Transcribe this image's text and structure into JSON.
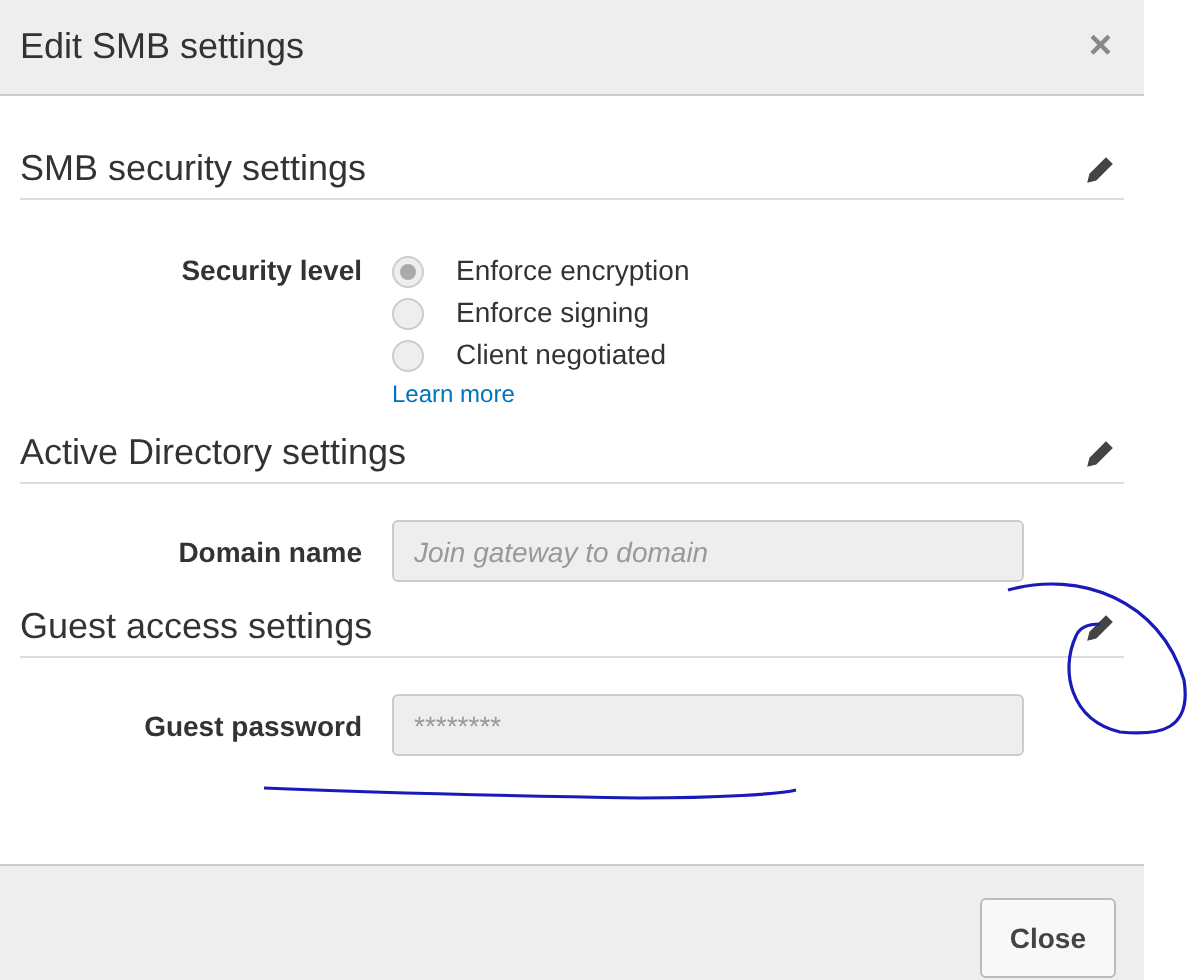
{
  "dialog": {
    "title": "Edit SMB settings",
    "close_icon": "×"
  },
  "sections": [
    {
      "title": "SMB security settings",
      "kind": "radios",
      "label": "Security level",
      "options": [
        {
          "label": "Enforce encryption",
          "selected": true,
          "disabled": true
        },
        {
          "label": "Enforce signing",
          "selected": false,
          "disabled": true
        },
        {
          "label": "Client negotiated",
          "selected": false,
          "disabled": true
        }
      ],
      "link": "Learn more"
    },
    {
      "title": "Active Directory settings",
      "kind": "field",
      "label": "Domain name",
      "placeholder": "Join gateway to domain",
      "disabled": true
    },
    {
      "title": "Guest access settings",
      "kind": "field",
      "label": "Guest password",
      "value": "********",
      "disabled": true
    }
  ],
  "buttons": [
    "Close"
  ]
}
